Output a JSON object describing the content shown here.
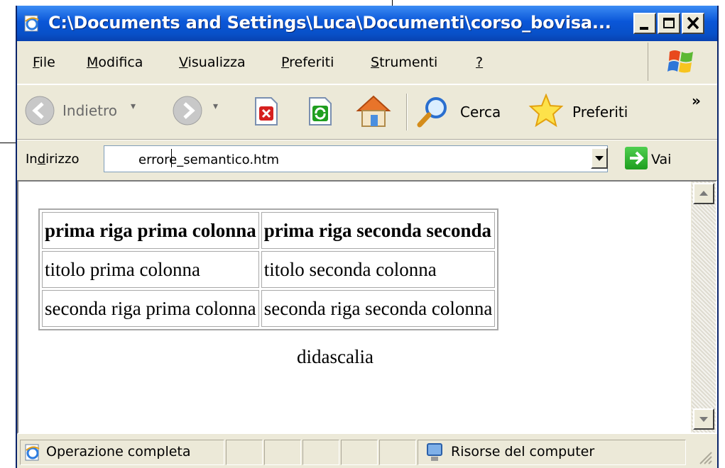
{
  "window": {
    "title": "C:\\Documents and Settings\\Luca\\Documenti\\corso_bovisa..."
  },
  "menu": {
    "items": [
      {
        "accel": "F",
        "rest": "ile"
      },
      {
        "accel": "M",
        "rest": "odifica"
      },
      {
        "accel": "V",
        "rest": "isualizza"
      },
      {
        "accel": "P",
        "rest": "referiti"
      },
      {
        "accel": "S",
        "rest": "trumenti"
      },
      {
        "accel": "?",
        "rest": ""
      }
    ]
  },
  "toolbar": {
    "back_label": "Indietro",
    "search_label": "Cerca",
    "favorites_label": "Preferiti",
    "overflow": "»"
  },
  "address": {
    "label_pre": "In",
    "label_accel": "d",
    "label_post": "irizzo",
    "value": "errore_semantico.htm",
    "go_label": "Vai"
  },
  "document": {
    "table": [
      [
        "prima riga prima colonna",
        "prima riga seconda seconda"
      ],
      [
        "titolo prima colonna",
        "titolo seconda colonna"
      ],
      [
        "seconda riga prima colonna",
        "seconda riga seconda colonna"
      ]
    ],
    "caption": "didascalia"
  },
  "status": {
    "text": "Operazione completa",
    "zone": "Risorse del computer"
  },
  "colors": {
    "titlebar": "#0a56d8",
    "chrome": "#ece9d8",
    "close_red": "#d6201f",
    "accent_green": "#1f9e1f"
  },
  "icons": {
    "app": "ie-page-icon",
    "back": "back-arrow-icon",
    "forward": "forward-arrow-icon",
    "stop": "stop-icon",
    "refresh": "refresh-icon",
    "home": "home-icon",
    "search": "search-icon",
    "favorites": "star-icon",
    "go": "go-arrow-icon",
    "computer": "my-computer-icon"
  }
}
